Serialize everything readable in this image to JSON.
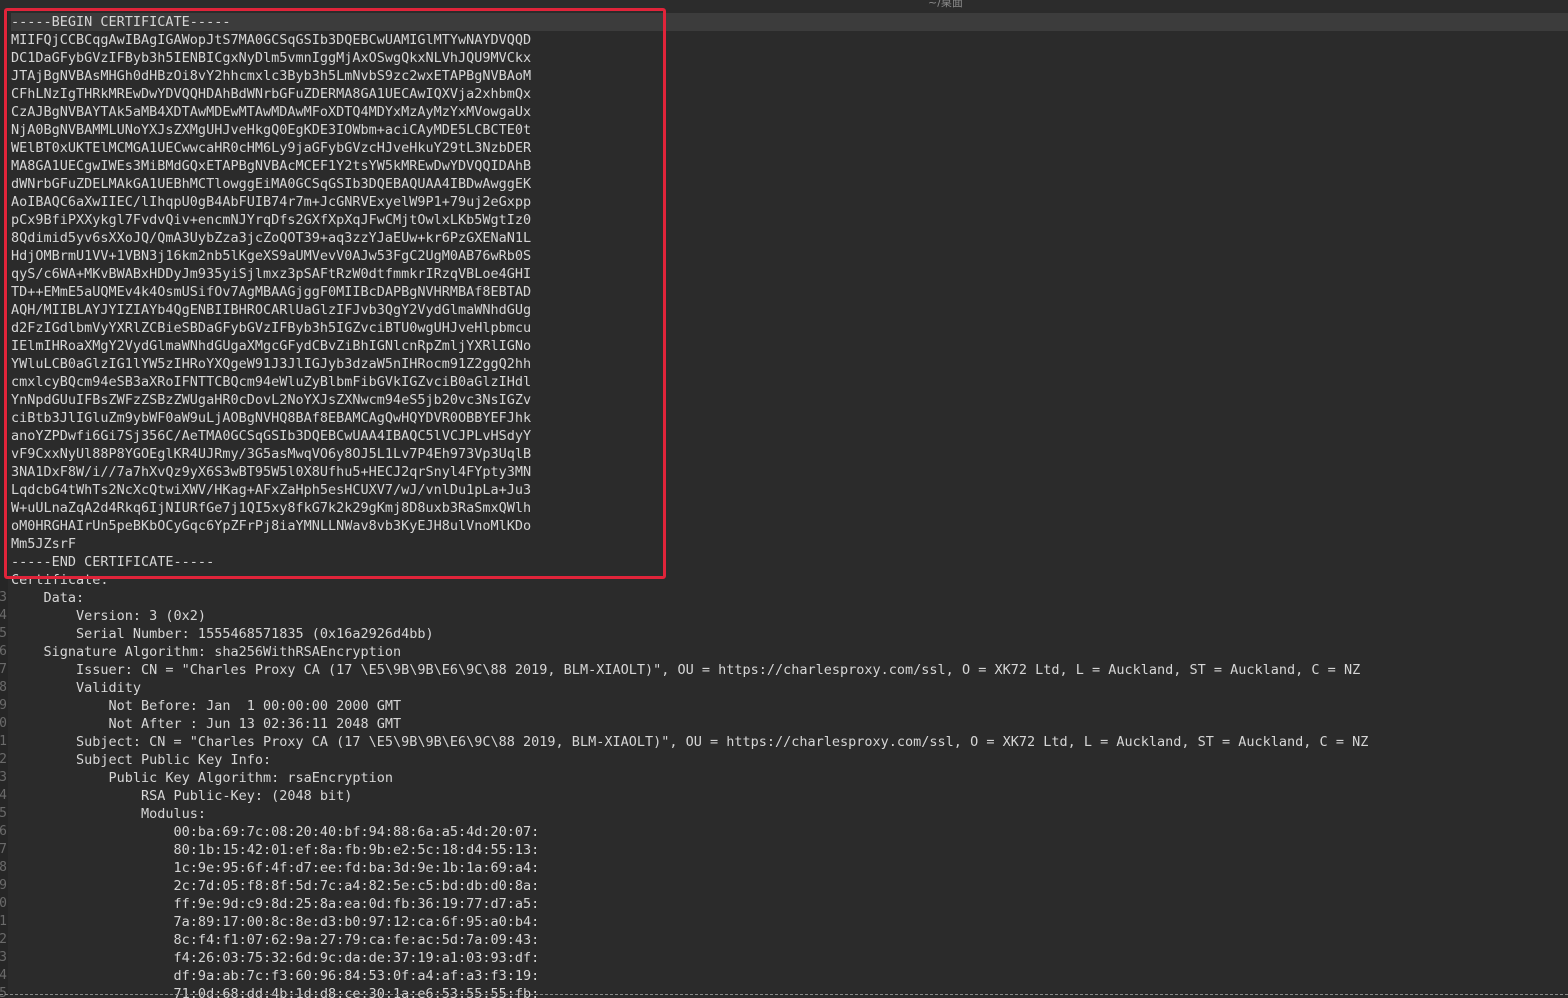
{
  "window": {
    "title": "~/桌面",
    "left_title": "     "
  },
  "colors": {
    "background": "#2b2b2b",
    "text": "#d6d6d6",
    "highlight_border": "#e0243a",
    "current_line": "#3c3c3c"
  },
  "gutter": {
    "numbers": [
      "",
      "",
      "",
      "",
      "",
      "",
      "",
      "",
      "",
      "",
      "",
      "",
      "",
      "",
      "",
      "",
      "",
      "",
      "",
      "",
      "",
      "",
      "",
      "",
      "",
      "",
      "",
      "",
      "",
      "",
      "",
      "",
      "3",
      "4",
      "5",
      "6",
      "7",
      "8",
      "9",
      "0",
      "1",
      "2",
      "3",
      "4",
      "5",
      "6",
      "7",
      "8",
      "9",
      "0",
      "1",
      "2",
      "3",
      "4",
      "5"
    ]
  },
  "pem": {
    "begin": "-----BEGIN CERTIFICATE-----",
    "lines": [
      "MIIFQjCCBCqgAwIBAgIGAWopJtS7MA0GCSqGSIb3DQEBCwUAMIGlMTYwNAYDVQQD",
      "DC1DaGFybGVzIFByb3h5IENBICgxNyDlm5vmnIggMjAxOSwgQkxNLVhJQU9MVCkx",
      "JTAjBgNVBAsMHGh0dHBzOi8vY2hhcmxlc3Byb3h5LmNvbS9zc2wxETAPBgNVBAoM",
      "CFhLNzIgTHRkMREwDwYDVQQHDAhBdWNrbGFuZDERMA8GA1UECAwIQXVja2xhbmQx",
      "CzAJBgNVBAYTAk5aMB4XDTAwMDEwMTAwMDAwMFoXDTQ4MDYxMzAyMzYxMVowgaUx",
      "NjA0BgNVBAMMLUNoYXJsZXMgUHJveHkgQ0EgKDE3IOWbm+aciCAyMDE5LCBCTE0t",
      "WElBT0xUKTElMCMGA1UECwwcaHR0cHM6Ly9jaGFybGVzcHJveHkuY29tL3NzbDER",
      "MA8GA1UECgwIWEs3MiBMdGQxETAPBgNVBAcMCEF1Y2tsYW5kMREwDwYDVQQIDAhB",
      "dWNrbGFuZDELMAkGA1UEBhMCTlowggEiMA0GCSqGSIb3DQEBAQUAA4IBDwAwggEK",
      "AoIBAQC6aXwIIEC/lIhqpU0gB4AbFUIB74r7m+JcGNRVExyelW9P1+79uj2eGxpp",
      "pCx9BfiPXXykgl7FvdvQiv+encmNJYrqDfs2GXfXpXqJFwCMjtOwlxLKb5WgtIz0",
      "8Qdimid5yv6sXXoJQ/QmA3UybZza3jcZoQOT39+aq3zzYJaEUw+kr6PzGXENaN1L",
      "HdjOMBrmU1VV+1VBN3j16km2nb5lKgeXS9aUMVevV0AJw53FgC2UgM0AB76wRb0S",
      "qyS/c6WA+MKvBWABxHDDyJm935yiSjlmxz3pSAFtRzW0dtfmmkrIRzqVBLoe4GHI",
      "TD++EMmE5aUQMEv4k4OsmUSifOv7AgMBAAGjggF0MIIBcDAPBgNVHRMBAf8EBTAD",
      "AQH/MIIBLAYJYIZIAYb4QgENBIIBHROCARlUaGlzIFJvb3QgY2VydGlmaWNhdGUg",
      "d2FzIGdlbmVyYXRlZCBieSBDaGFybGVzIFByb3h5IGZvciBTU0wgUHJveHlpbmcu",
      "IElmIHRoaXMgY2VydGlmaWNhdGUgaXMgcGFydCBvZiBhIGNlcnRpZmljYXRlIGNo",
      "YWluLCB0aGlzIG1lYW5zIHRoYXQgeW91J3JlIGJyb3dzaW5nIHRocm91Z2ggQ2hh",
      "cmxlcyBQcm94eSB3aXRoIFNTTCBQcm94eWluZyBlbmFibGVkIGZvciB0aGlzIHdl",
      "YnNpdGUuIFBsZWFzZSBzZWUgaHR0cDovL2NoYXJsZXNwcm94eS5jb20vc3NsIGZv",
      "ciBtb3JlIGluZm9ybWF0aW9uLjAOBgNVHQ8BAf8EBAMCAgQwHQYDVR0OBBYEFJhk",
      "anoYZPDwfi6Gi7Sj356C/AeTMA0GCSqGSIb3DQEBCwUAA4IBAQC5lVCJPLvHSdyY",
      "vF9CxxNyUl88P8YGOEglKR4UJRmy/3G5asMwqVO6y8OJ5L1Lv7P4Eh973Vp3UqlB",
      "3NA1DxF8W/i//7a7hXvQz9yX6S3wBT95W5l0X8Ufhu5+HECJ2qrSnyl4FYpty3MN",
      "LqdcbG4tWhTs2NcXcQtwiXWV/HKag+AFxZaHph5esHCUXV7/wJ/vnlDu1pLa+Ju3",
      "W+uULnaZqA2d4Rkq6IjNIURfGe7j1QI5xy8fkG7k2k29gKmj8D8uxb3RaSmxQWlh",
      "oM0HRGHAIrUn5peBKbOCyGqc6YpZFrPj8iaYMNLLNWav8vb3KyEJH8ulVnoMlKDo",
      "Mm5JZsrF"
    ],
    "end": "-----END CERTIFICATE-----"
  },
  "details": {
    "certificate_label": "Certificate:",
    "data_label": "    Data:",
    "version": "        Version: 3 (0x2)",
    "serial": "        Serial Number: 1555468571835 (0x16a2926d4bb)",
    "signature_algorithm": "    Signature Algorithm: sha256WithRSAEncryption",
    "issuer": "        Issuer: CN = \"Charles Proxy CA (17 \\E5\\9B\\9B\\E6\\9C\\88 2019, BLM-XIAOLT)\", OU = https://charlesproxy.com/ssl, O = XK72 Ltd, L = Auckland, ST = Auckland, C = NZ",
    "validity": "        Validity",
    "not_before": "            Not Before: Jan  1 00:00:00 2000 GMT",
    "not_after": "            Not After : Jun 13 02:36:11 2048 GMT",
    "subject": "        Subject: CN = \"Charles Proxy CA (17 \\E5\\9B\\9B\\E6\\9C\\88 2019, BLM-XIAOLT)\", OU = https://charlesproxy.com/ssl, O = XK72 Ltd, L = Auckland, ST = Auckland, C = NZ",
    "spki": "        Subject Public Key Info:",
    "pk_algorithm": "            Public Key Algorithm: rsaEncryption",
    "rsa_key": "                RSA Public-Key: (2048 bit)",
    "modulus_label": "                Modulus:",
    "modulus": [
      "                    00:ba:69:7c:08:20:40:bf:94:88:6a:a5:4d:20:07:",
      "                    80:1b:15:42:01:ef:8a:fb:9b:e2:5c:18:d4:55:13:",
      "                    1c:9e:95:6f:4f:d7:ee:fd:ba:3d:9e:1b:1a:69:a4:",
      "                    2c:7d:05:f8:8f:5d:7c:a4:82:5e:c5:bd:db:d0:8a:",
      "                    ff:9e:9d:c9:8d:25:8a:ea:0d:fb:36:19:77:d7:a5:",
      "                    7a:89:17:00:8c:8e:d3:b0:97:12:ca:6f:95:a0:b4:",
      "                    8c:f4:f1:07:62:9a:27:79:ca:fe:ac:5d:7a:09:43:",
      "                    f4:26:03:75:32:6d:9c:da:de:37:19:a1:03:93:df:",
      "                    df:9a:ab:7c:f3:60:96:84:53:0f:a4:af:a3:f3:19:",
      "                    71:0d:68:dd:4b:1d:d8:ce:30:1a:e6:53:55:55:fb:"
    ]
  }
}
